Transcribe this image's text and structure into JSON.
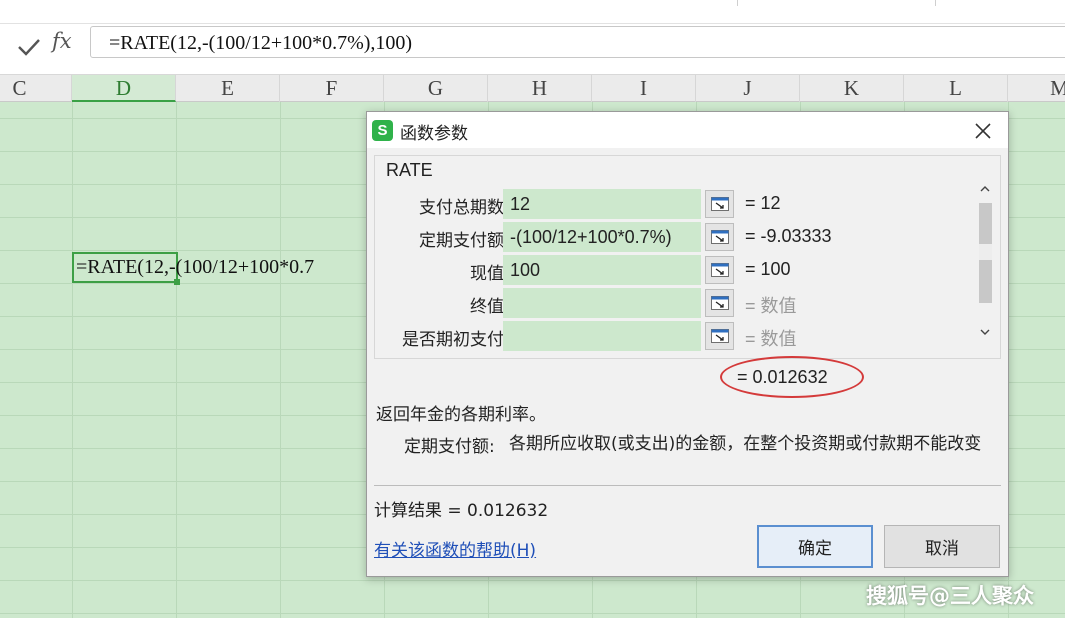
{
  "formula_bar": {
    "confirm_icon": "checkmark-icon",
    "fx_label": "fx",
    "formula": "=RATE(12,-(100/12+100*0.7%),100)"
  },
  "columns": [
    "C",
    "D",
    "E",
    "F",
    "G",
    "H",
    "I",
    "J",
    "K",
    "L",
    "M"
  ],
  "active_column": "D",
  "active_cell_text": "=RATE(12,-(100/12+100*0.7",
  "dialog": {
    "title": "函数参数",
    "logo_text": "S",
    "function_name": "RATE",
    "params": [
      {
        "label": "支付总期数",
        "value": "12",
        "result": "= 12",
        "empty": false
      },
      {
        "label": "定期支付额",
        "value": "-(100/12+100*0.7%)",
        "result": "= -9.03333",
        "empty": false
      },
      {
        "label": "现值",
        "value": "100",
        "result": "= 100",
        "empty": false
      },
      {
        "label": "终值",
        "value": "",
        "result": "= 数值",
        "empty": true
      },
      {
        "label": "是否期初支付",
        "value": "",
        "result": "= 数值",
        "empty": true
      }
    ],
    "total_result": "= 0.012632",
    "description": "返回年金的各期利率。",
    "arg_name": "定期支付额:",
    "arg_description": "各期所应收取(或支出)的金额，在整个投资期或付款期不能改变",
    "calc_result": "计算结果 = 0.012632",
    "help_link": "有关该函数的帮助(H)",
    "ok_label": "确定",
    "cancel_label": "取消"
  },
  "watermark": "搜狐号@三人聚众",
  "colors": {
    "grid_background": "#cde8cd",
    "input_background": "#cde8cd",
    "active_accent": "#3d9f45",
    "highlight_ellipse": "#d43a3a",
    "link": "#1f4fb8"
  }
}
